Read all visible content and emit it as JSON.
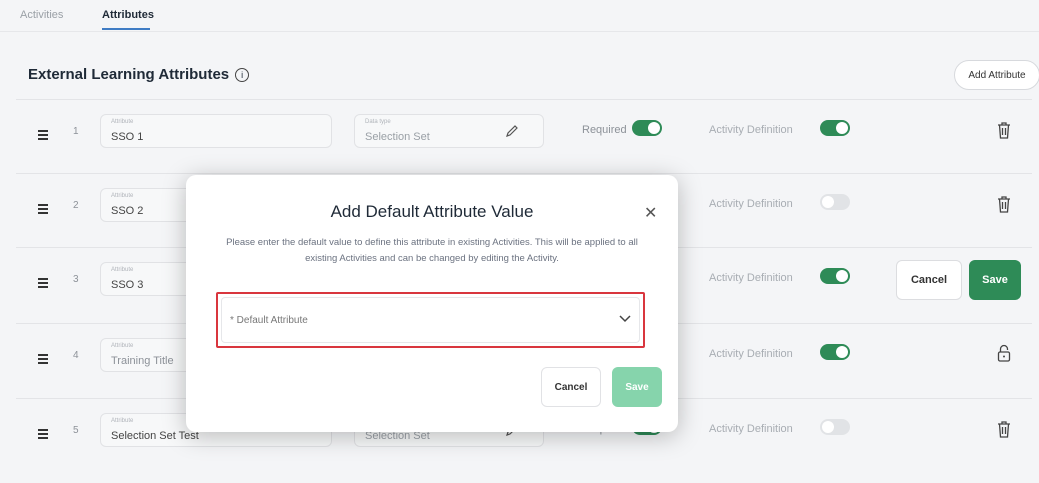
{
  "tabs": [
    {
      "label": "Activities",
      "active": false
    },
    {
      "label": "Attributes",
      "active": true
    }
  ],
  "section": {
    "title": "External Learning Attributes",
    "info_icon": "info-icon",
    "add_button": "Add Attribute"
  },
  "field_labels": {
    "attribute": "Attribute",
    "data_type": "Data type"
  },
  "rows": [
    {
      "index": "1",
      "attribute": "SSO 1",
      "data_type": "Selection Set",
      "required_label": "Required",
      "activity_label": "Activity Definition",
      "required_on": true,
      "activity_on": true,
      "action": "trash-icon"
    },
    {
      "index": "2",
      "attribute": "SSO 2",
      "activity_label": "Activity Definition",
      "activity_on": false,
      "action": "trash-icon"
    },
    {
      "index": "3",
      "attribute": "SSO 3",
      "activity_label": "Activity Definition",
      "activity_on": true,
      "action": "cancel-save",
      "cancel_label": "Cancel",
      "save_label": "Save"
    },
    {
      "index": "4",
      "attribute": "Training Title",
      "activity_label": "Activity Definition",
      "activity_on": true,
      "action": "lock-icon"
    },
    {
      "index": "5",
      "attribute": "Selection Set Test",
      "data_type": "Selection Set",
      "required_label": "Required",
      "activity_label": "Activity Definition",
      "required_on": true,
      "activity_on": false,
      "action": "trash-icon"
    }
  ],
  "modal": {
    "title": "Add Default Attribute Value",
    "close_icon": "close-icon",
    "description": "Please enter the default value to define this attribute in existing Activities. This will be applied to all existing Activities and can be changed by editing the Activity.",
    "select_placeholder": "* Default Attribute",
    "cancel_label": "Cancel",
    "save_label": "Save"
  },
  "colors": {
    "accent_green": "#2e8b57",
    "save_disabled": "#86d4ac",
    "highlight_red": "#d9363e",
    "tab_underline": "#3f7cc4"
  }
}
